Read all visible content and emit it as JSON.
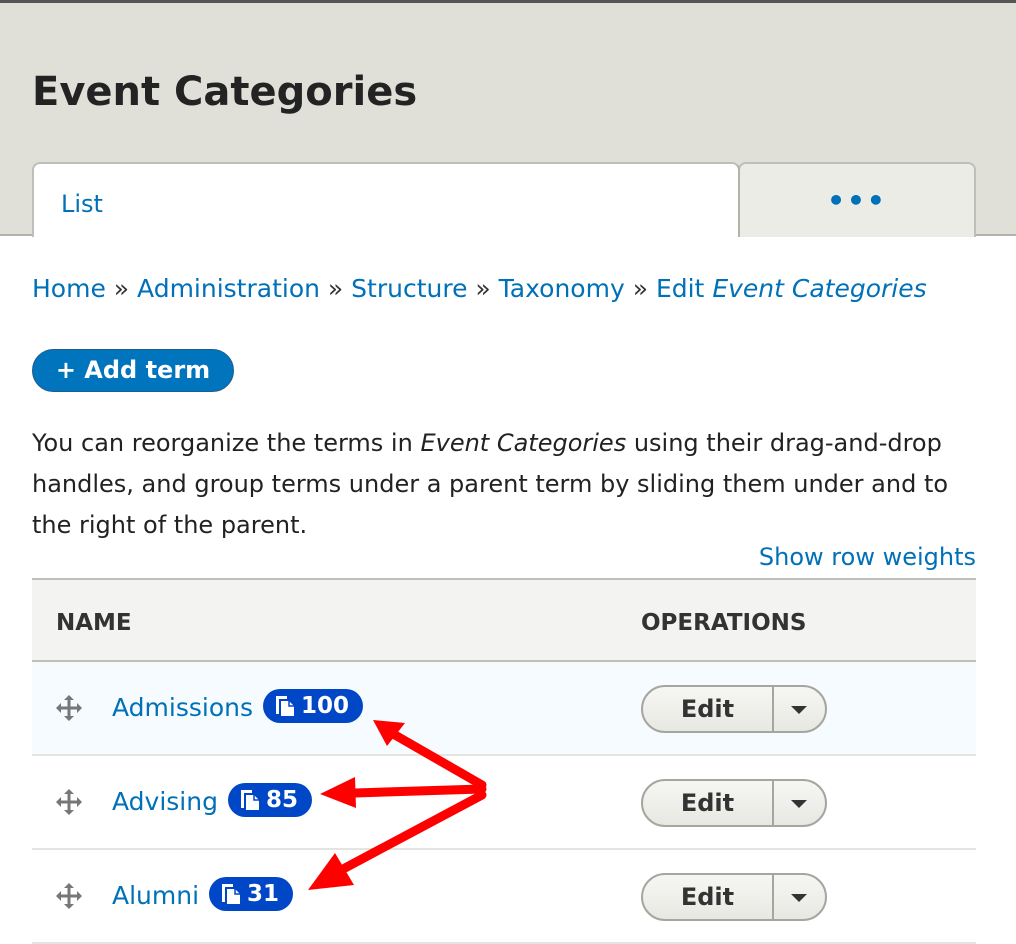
{
  "header": {
    "title": "Event Categories"
  },
  "tabs": [
    {
      "label": "List",
      "active": true
    },
    {
      "label": "•••",
      "icon": "more-icon"
    }
  ],
  "breadcrumb": {
    "items": [
      "Home",
      "Administration",
      "Structure",
      "Taxonomy"
    ],
    "separator": "»",
    "last_prefix": "Edit",
    "last_em": "Event Categories"
  },
  "actions": {
    "add_term": "+ Add term"
  },
  "description": {
    "before": "You can reorganize the terms in ",
    "em": "Event Categories",
    "after": " using their drag-and-drop handles, and group terms under a parent term by sliding them under and to the right of the parent."
  },
  "show_weights": "Show row weights",
  "table": {
    "headers": {
      "name": "NAME",
      "operations": "OPERATIONS"
    },
    "rows": [
      {
        "name": "Admissions",
        "count": "100",
        "op": "Edit"
      },
      {
        "name": "Advising",
        "count": "85",
        "op": "Edit"
      },
      {
        "name": "Alumni",
        "count": "31",
        "op": "Edit"
      }
    ]
  },
  "colors": {
    "link": "#0071b8",
    "badge": "#0047c7",
    "annotation_arrow": "#ff0000",
    "button": "#0074bd"
  }
}
